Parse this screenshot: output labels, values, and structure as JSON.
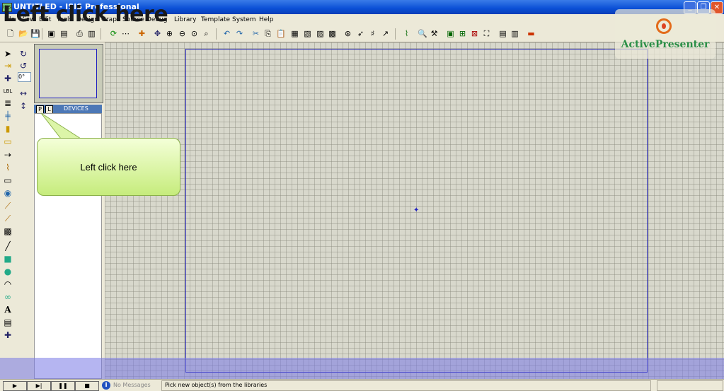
{
  "window": {
    "title": "UNTITLED - ISIS Professional",
    "app_icon": "ISIS"
  },
  "menu": [
    "File",
    "View",
    "Edit",
    "Tools",
    "Design",
    "Graph",
    "Source",
    "Debug",
    "Library",
    "Template",
    "System",
    "Help"
  ],
  "overlay": {
    "caption": "Left click here",
    "callout_text": "Left click here",
    "logo_text": "ActivePresenter"
  },
  "left_panel": {
    "angle": "0°",
    "pick_button": "P",
    "library_button": "L",
    "selector_title": "DEVICES"
  },
  "status": {
    "messages": "No Messages",
    "hint": "Pick new object(s) from the libraries"
  },
  "colors": {
    "title_bar": "#0a4fd6",
    "canvas": "#d8d8cc",
    "sheet_border": "#2020b0",
    "callout": "#c6ec7c",
    "logo": "#2a8f46"
  }
}
